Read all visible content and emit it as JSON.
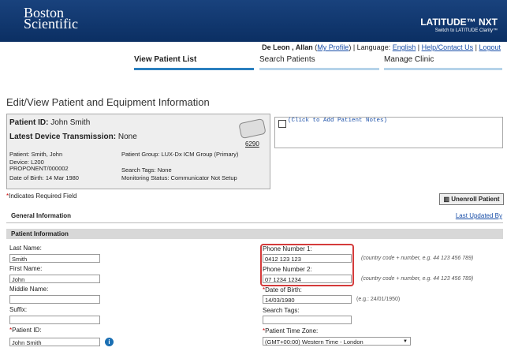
{
  "brand": {
    "logo_line1": "Boston",
    "logo_line2": "Scientific",
    "product": "LATITUDE™ NXT",
    "product_sub": "Switch to LATITUDE Clarity™"
  },
  "topnav": {
    "user": "De Leon , Allan",
    "profile": "My Profile",
    "language_label": "| Language:",
    "language": "English",
    "help": "Help/Contact Us",
    "logout": "Logout"
  },
  "tabs": [
    "View Patient List",
    "Search Patients",
    "Manage Clinic"
  ],
  "page_title": "Edit/View Patient and Equipment Information",
  "patient_summary": {
    "id_label": "Patient ID:",
    "id_value": "John Smith",
    "transmission_label": "Latest Device Transmission:",
    "transmission_value": "None",
    "patient": "Patient: Smith, John",
    "device": "Device: L200",
    "device_model": "PROPONENT/000002",
    "dob": "Date of Birth: 14 Mar 1980",
    "group": "Patient Group: LUX-Dx ICM Group (Primary)",
    "search_tags": "Search Tags: None",
    "monitoring": "Monitoring Status: Communicator Not Setup",
    "device_number": "6290"
  },
  "notes_placeholder": "(Click to Add Patient Notes)",
  "required_note": "Indicates Required Field",
  "unenroll_label": "Unenroll Patient",
  "general_info": "General Information",
  "last_updated": "Last Updated By",
  "section_title": "Patient Information",
  "fields": {
    "last_name_label": "Last Name:",
    "last_name": "Smith",
    "first_name_label": "First Name:",
    "first_name": "John",
    "middle_name_label": "Middle Name:",
    "middle_name": "",
    "suffix_label": "Suffix:",
    "suffix": "",
    "patient_id_label": "Patient ID:",
    "patient_id": "John Smith",
    "phone1_label": "Phone Number 1:",
    "phone1": "0412 123 123",
    "phone2_label": "Phone Number 2:",
    "phone2": "07 1234 1234",
    "phone_hint": "(country code + number, e.g. 44 123 456 789)",
    "dob_label": "Date of Birth:",
    "dob": "14/03/1980",
    "dob_hint": "(e.g.: 24/01/1950)",
    "tags_label": "Search Tags:",
    "tags": "",
    "timezone_label": "Patient Time Zone:",
    "timezone": "(GMT+00:00) Western Time - London"
  }
}
